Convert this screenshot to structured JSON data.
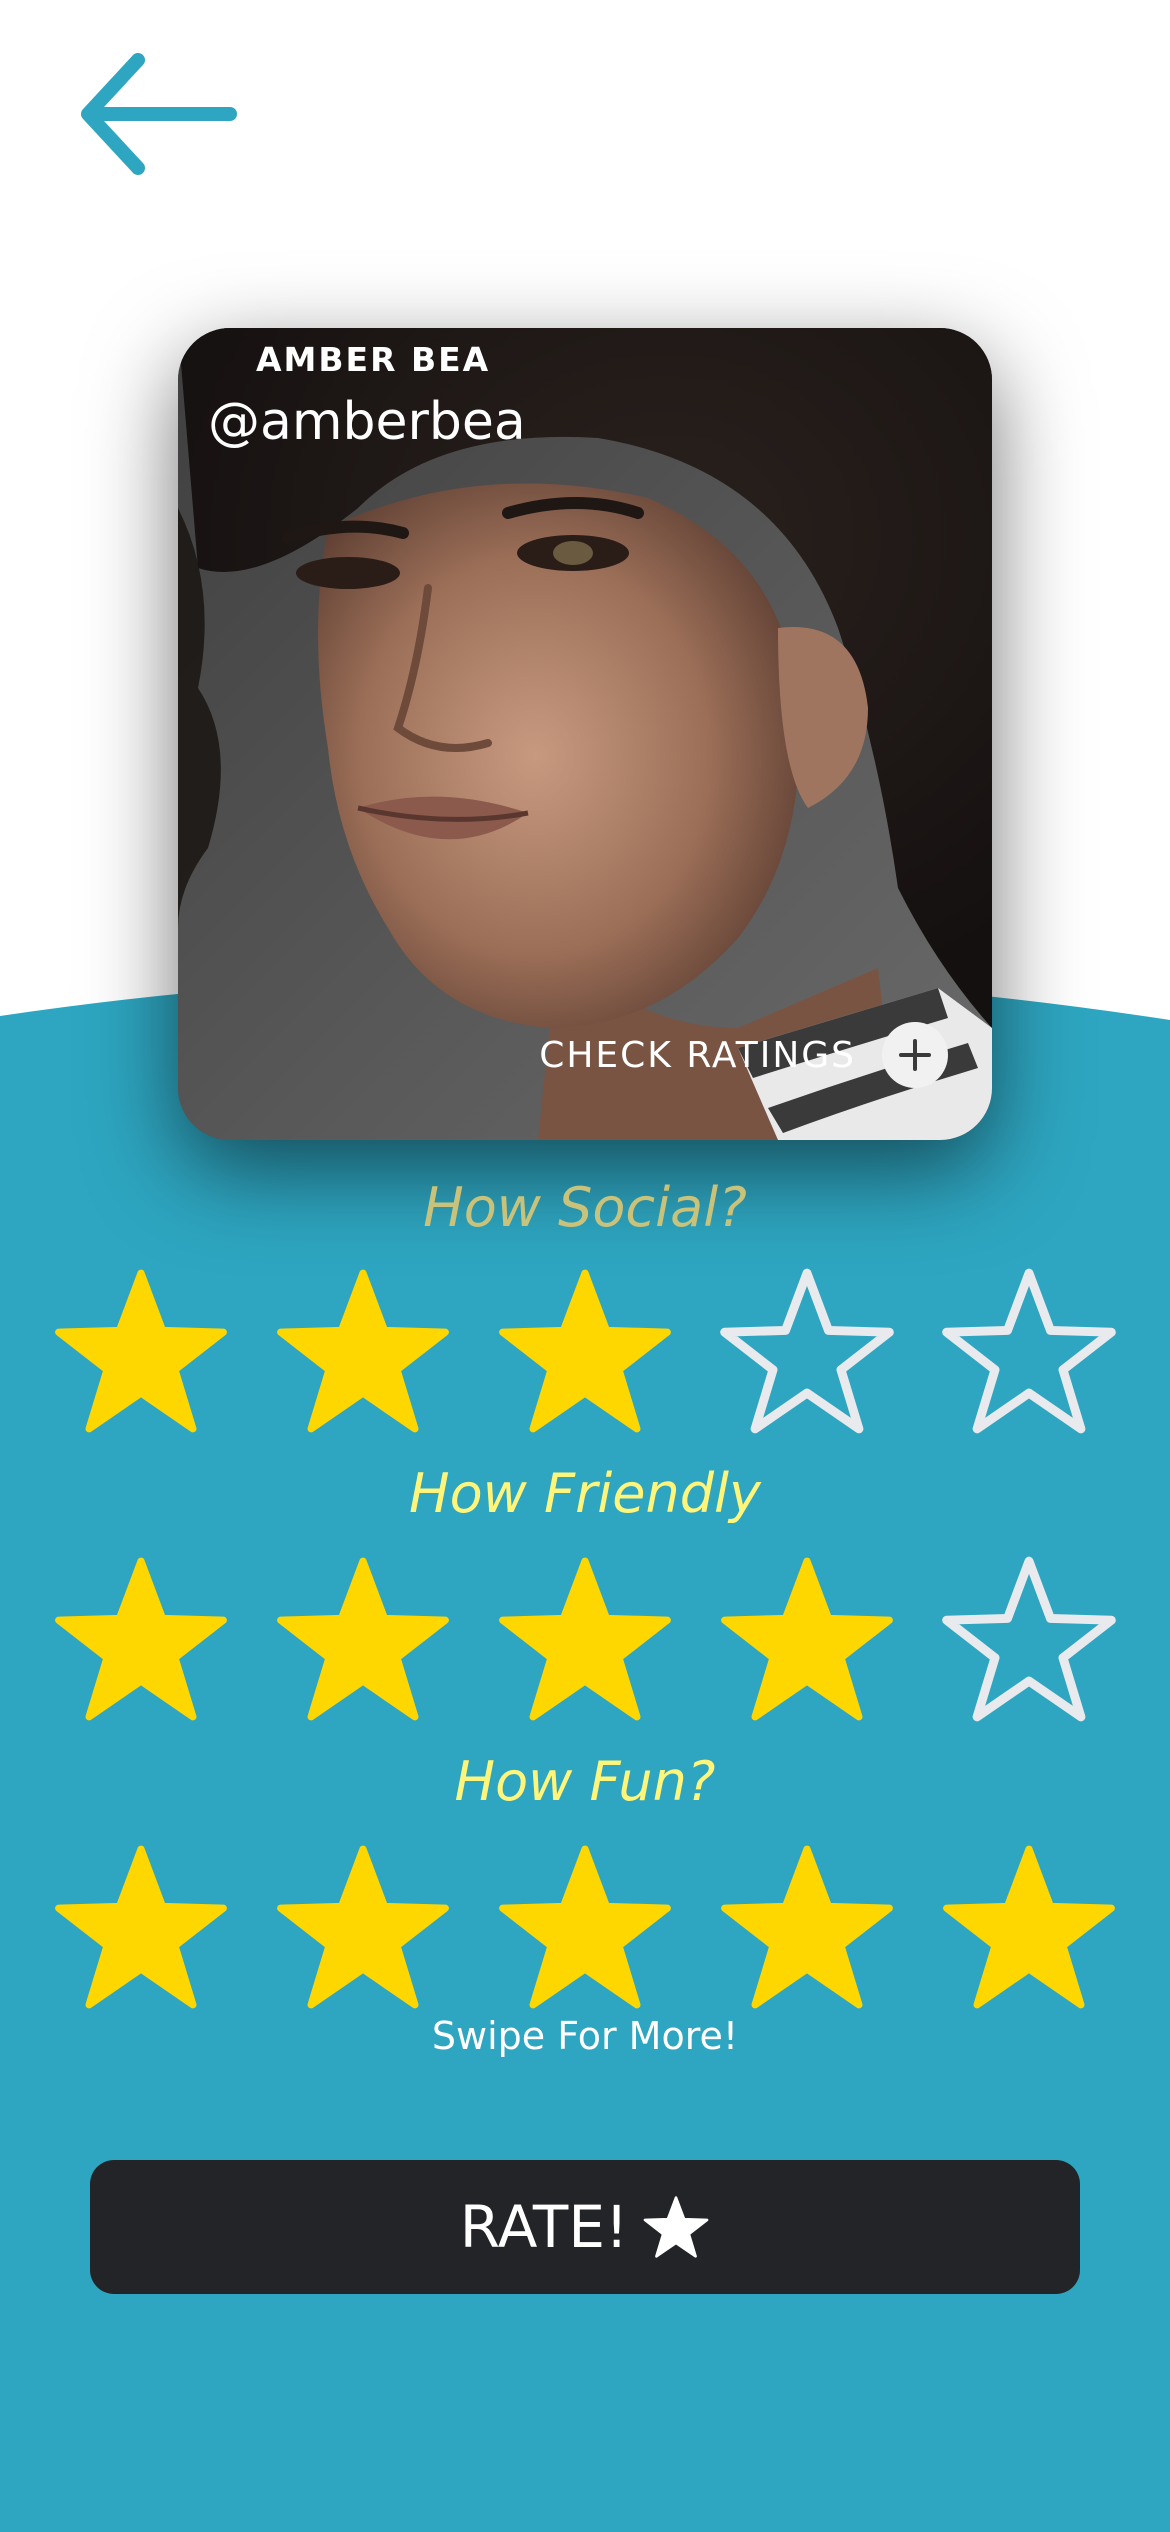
{
  "colors": {
    "teal": "#2ea6c1",
    "star_filled": "#ffd700",
    "star_empty_stroke": "#e8eaed",
    "question_social": "#c9c27a",
    "question_other": "#fff57a",
    "button_bg": "#232428"
  },
  "nav": {
    "back_icon": "arrow-left-icon"
  },
  "profile": {
    "name": "AMBER BEA",
    "handle": "@amberbea",
    "check_ratings_label": "CHECK RATINGS",
    "check_ratings_icon": "plus-circle-icon"
  },
  "ratings": [
    {
      "question": "How Social?",
      "value": 3,
      "max": 5
    },
    {
      "question": "How Friendly",
      "value": 4,
      "max": 5
    },
    {
      "question": "How Fun?",
      "value": 5,
      "max": 5
    }
  ],
  "swipe_hint": "Swipe For More!",
  "rate_button": {
    "label": "RATE!",
    "icon": "star-icon"
  }
}
